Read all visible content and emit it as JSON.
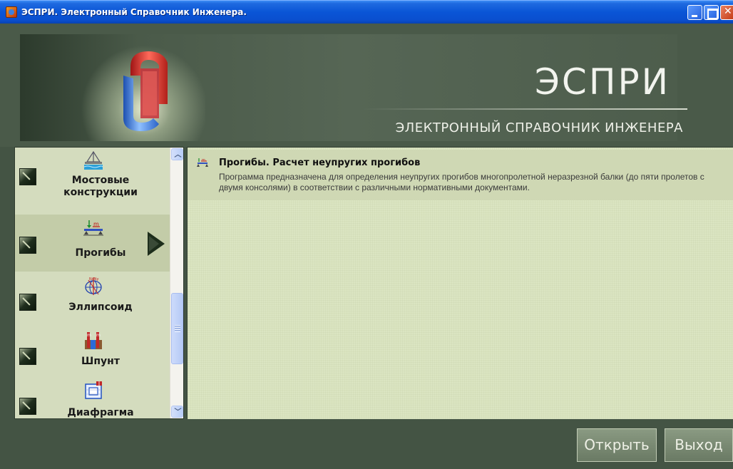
{
  "window": {
    "title": "ЭСПРИ. Электронный Справочник Инженера."
  },
  "banner": {
    "title": "ЭСПРИ",
    "subtitle": "ЭЛЕКТРОННЫЙ СПРАВОЧНИК ИНЖЕНЕРА"
  },
  "nav": {
    "items": [
      {
        "label": "Мостовые конструкции",
        "icon": "bridge-icon",
        "selected": false
      },
      {
        "label": "Прогибы",
        "icon": "beam-deflection-icon",
        "selected": true
      },
      {
        "label": "Эллипсоид",
        "icon": "ellipsoid-icon",
        "selected": false
      },
      {
        "label": "Шпунт",
        "icon": "sheet-pile-icon",
        "selected": false
      },
      {
        "label": "Диафрагма",
        "icon": "diaphragm-icon",
        "selected": false
      }
    ]
  },
  "content": {
    "programs": [
      {
        "title": "Прогибы. Расчет неупругих прогибов",
        "description": "Программа предназначена для определения неупругих прогибов многопролетной неразрезной балки (до пяти пролетов с двумя консолями) в соответствии с различными нормативными документами."
      }
    ]
  },
  "buttons": {
    "open": "Открыть",
    "exit": "Выход"
  },
  "colors": {
    "frame": "#445444",
    "panel": "#d4dcbe",
    "content": "#dbe5c2",
    "selected": "#c3cca8"
  }
}
